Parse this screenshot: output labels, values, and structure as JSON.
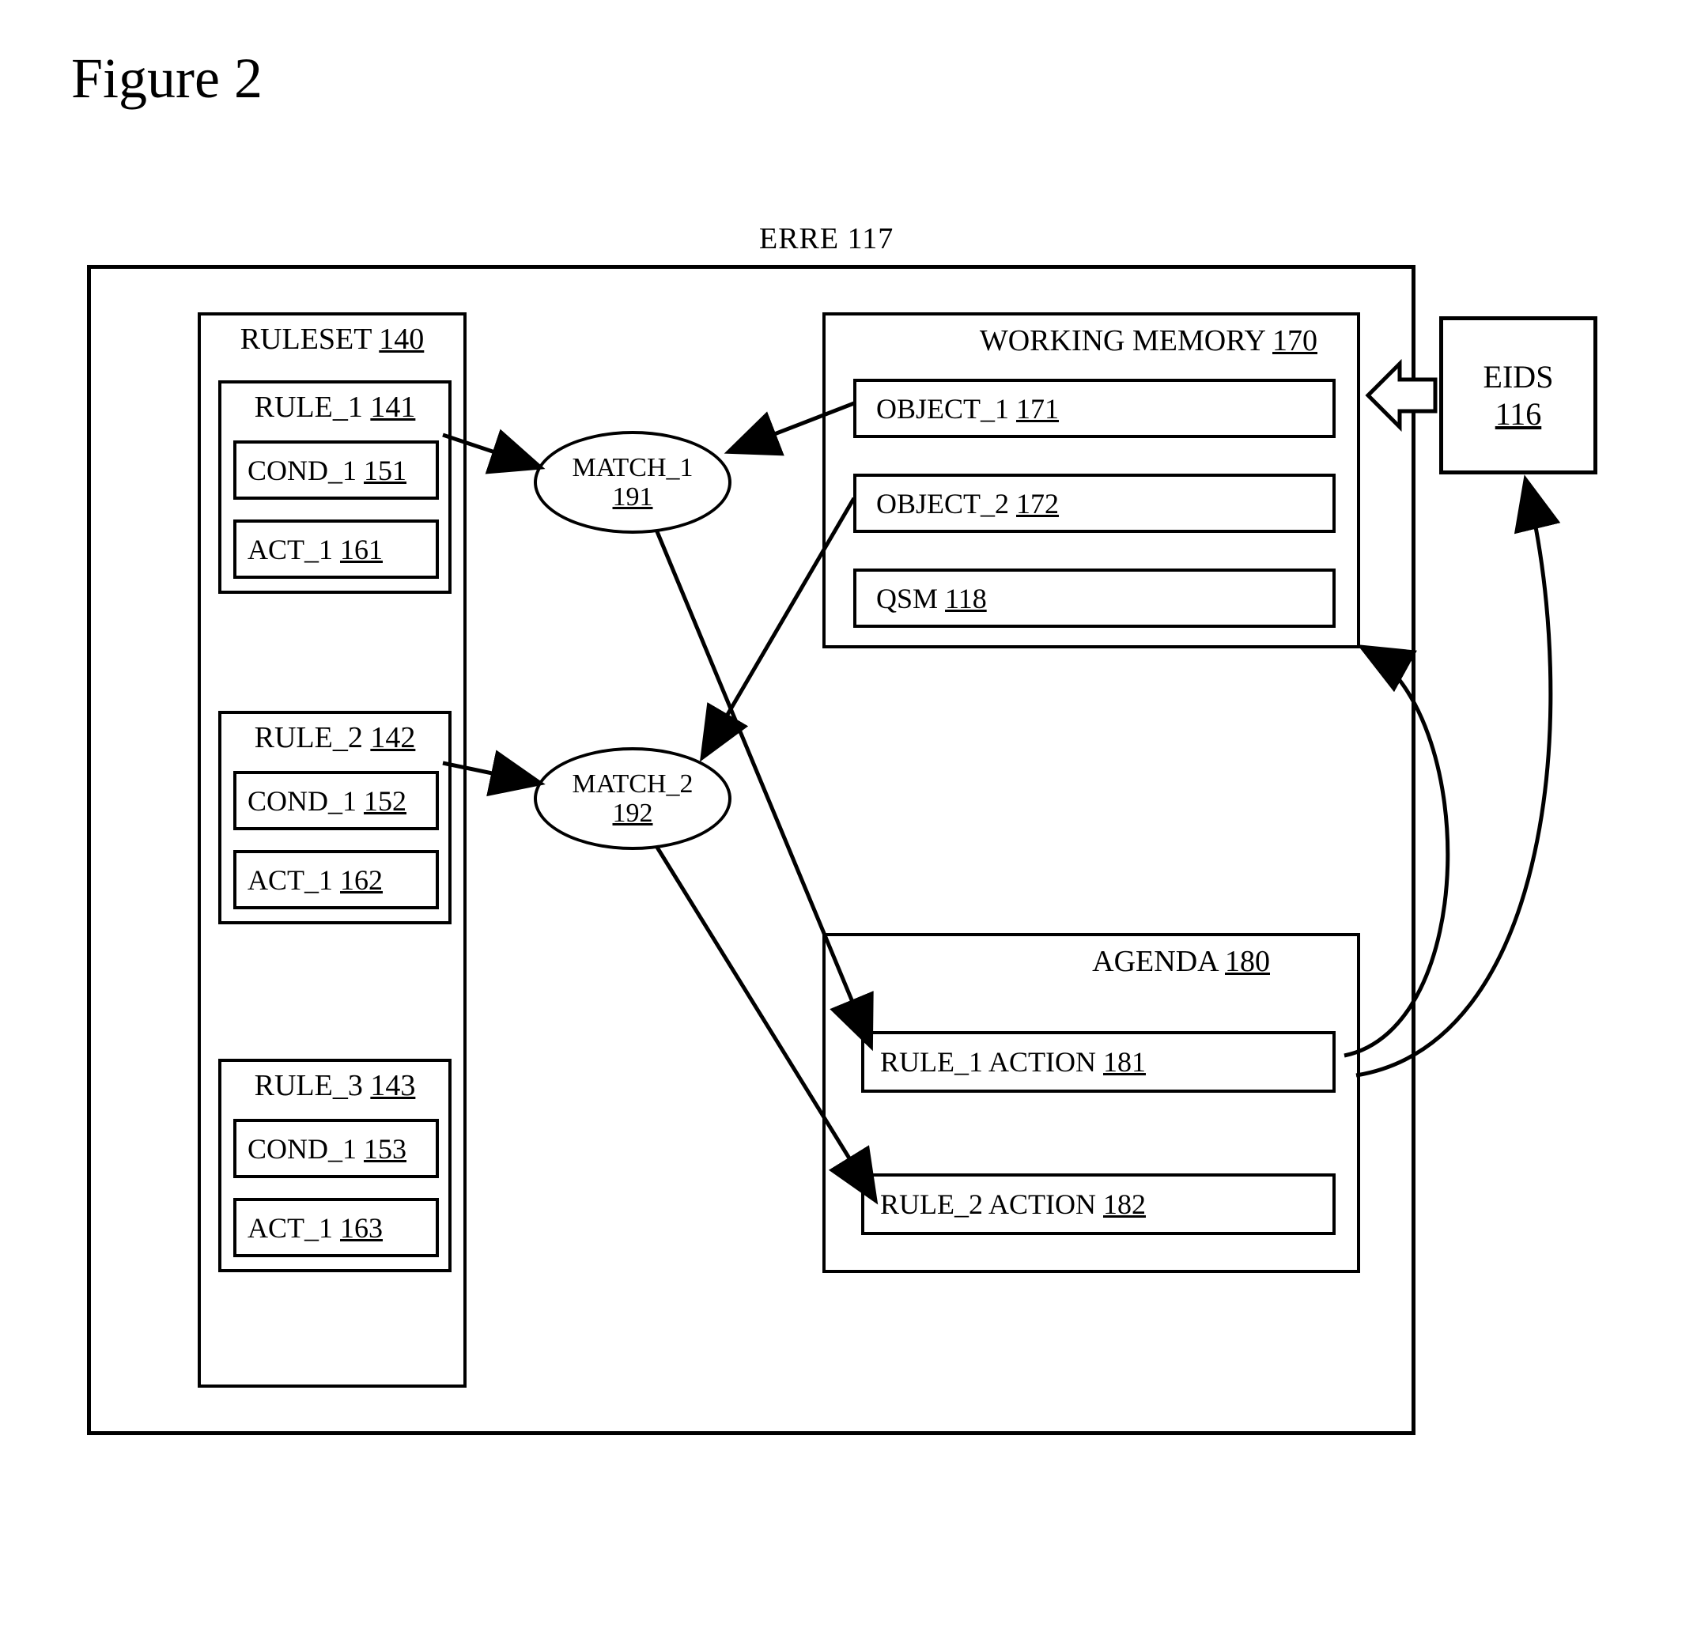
{
  "figure_title": "Figure 2",
  "erre": {
    "label": "ERRE 117"
  },
  "ruleset": {
    "title_text": "RULESET",
    "title_ref": "140",
    "rules": [
      {
        "title_text": "RULE_1",
        "title_ref": "141",
        "cond_text": "COND_1",
        "cond_ref": "151",
        "act_text": "ACT_1",
        "act_ref": "161"
      },
      {
        "title_text": "RULE_2",
        "title_ref": "142",
        "cond_text": "COND_1",
        "cond_ref": "152",
        "act_text": "ACT_1",
        "act_ref": "162"
      },
      {
        "title_text": "RULE_3",
        "title_ref": "143",
        "cond_text": "COND_1",
        "cond_ref": "153",
        "act_text": "ACT_1",
        "act_ref": "163"
      }
    ]
  },
  "working_memory": {
    "title_text": "WORKING MEMORY",
    "title_ref": "170",
    "items": [
      {
        "text": "OBJECT_1",
        "ref": "171"
      },
      {
        "text": "OBJECT_2",
        "ref": "172"
      },
      {
        "text": "QSM",
        "ref": "118"
      }
    ]
  },
  "agenda": {
    "title_text": "AGENDA",
    "title_ref": "180",
    "items": [
      {
        "text": "RULE_1 ACTION",
        "ref": "181"
      },
      {
        "text": "RULE_2 ACTION",
        "ref": "182"
      }
    ]
  },
  "matches": [
    {
      "text": "MATCH_1",
      "ref": "191"
    },
    {
      "text": "MATCH_2",
      "ref": "192"
    }
  ],
  "eids": {
    "text": "EIDS",
    "ref": "116"
  }
}
